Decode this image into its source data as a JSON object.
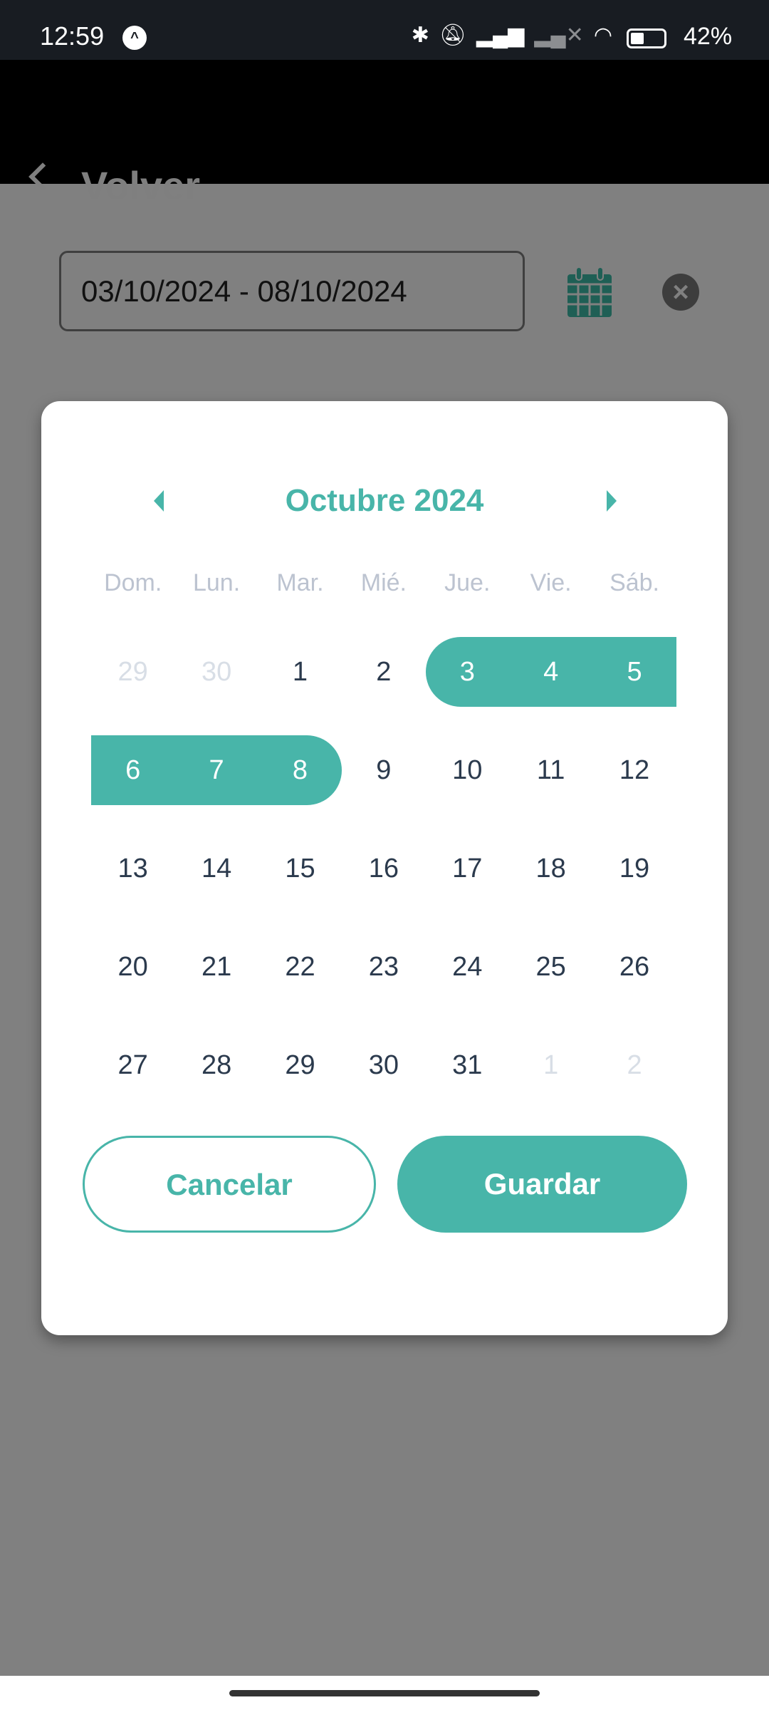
{
  "status_bar": {
    "time": "12:59",
    "battery_percent": "42%",
    "battery_level": 0.42,
    "icons": [
      "app-notification-icon",
      "bluetooth-icon",
      "bell-off-icon",
      "signal-icon",
      "signal-off-icon",
      "wifi-icon",
      "battery-icon"
    ]
  },
  "header": {
    "back_label": "Volver"
  },
  "date_field": {
    "value": "03/10/2024 - 08/10/2024"
  },
  "calendar": {
    "month_label": "Octubre 2024",
    "weekdays": [
      "Dom.",
      "Lun.",
      "Mar.",
      "Mié.",
      "Jue.",
      "Vie.",
      "Sáb."
    ],
    "weeks": [
      [
        {
          "d": "29",
          "out": true
        },
        {
          "d": "30",
          "out": true
        },
        {
          "d": "1"
        },
        {
          "d": "2"
        },
        {
          "d": "3",
          "sel": true,
          "start": true
        },
        {
          "d": "4",
          "sel": true
        },
        {
          "d": "5",
          "sel": true
        }
      ],
      [
        {
          "d": "6",
          "sel": true
        },
        {
          "d": "7",
          "sel": true
        },
        {
          "d": "8",
          "sel": true,
          "end": true
        },
        {
          "d": "9"
        },
        {
          "d": "10"
        },
        {
          "d": "11"
        },
        {
          "d": "12"
        }
      ],
      [
        {
          "d": "13"
        },
        {
          "d": "14"
        },
        {
          "d": "15"
        },
        {
          "d": "16"
        },
        {
          "d": "17"
        },
        {
          "d": "18"
        },
        {
          "d": "19"
        }
      ],
      [
        {
          "d": "20"
        },
        {
          "d": "21"
        },
        {
          "d": "22"
        },
        {
          "d": "23"
        },
        {
          "d": "24"
        },
        {
          "d": "25"
        },
        {
          "d": "26"
        }
      ],
      [
        {
          "d": "27"
        },
        {
          "d": "28"
        },
        {
          "d": "29"
        },
        {
          "d": "30"
        },
        {
          "d": "31"
        },
        {
          "d": "1",
          "out": true
        },
        {
          "d": "2",
          "out": true
        }
      ]
    ],
    "cancel_label": "Cancelar",
    "save_label": "Guardar"
  },
  "colors": {
    "accent": "#48b5a9",
    "calendar_icon": "#1f5f55"
  }
}
